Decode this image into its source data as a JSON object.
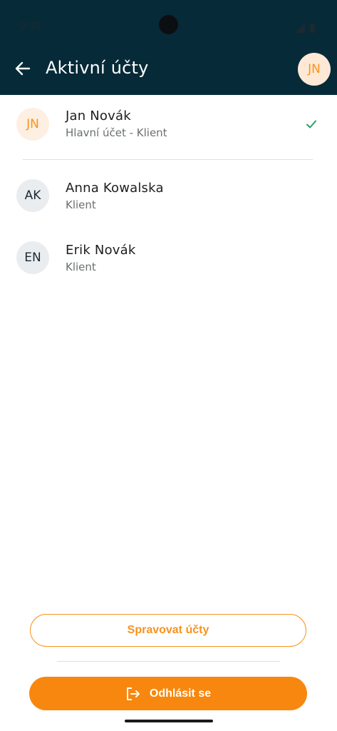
{
  "status_bar": {
    "time": "9:30"
  },
  "header": {
    "back_icon": "arrow-left-icon",
    "title": "Aktivní účty",
    "avatar_initials": "JN"
  },
  "accounts": [
    {
      "initials": "JN",
      "name": "Jan Novák",
      "subtitle": "Hlavní účet - Klient",
      "selected": true
    },
    {
      "initials": "AK",
      "name": "Anna Kowalska",
      "subtitle": "Klient",
      "selected": false
    },
    {
      "initials": "EN",
      "name": "Erik Novák",
      "subtitle": "Klient",
      "selected": false
    }
  ],
  "actions": {
    "manage_label": "Spravovat účty",
    "logout_label": "Odhlásit se",
    "logout_icon": "logout-icon"
  },
  "colors": {
    "header_bg": "#062a38",
    "accent": "#f7931e",
    "check": "#2e9e6a"
  }
}
